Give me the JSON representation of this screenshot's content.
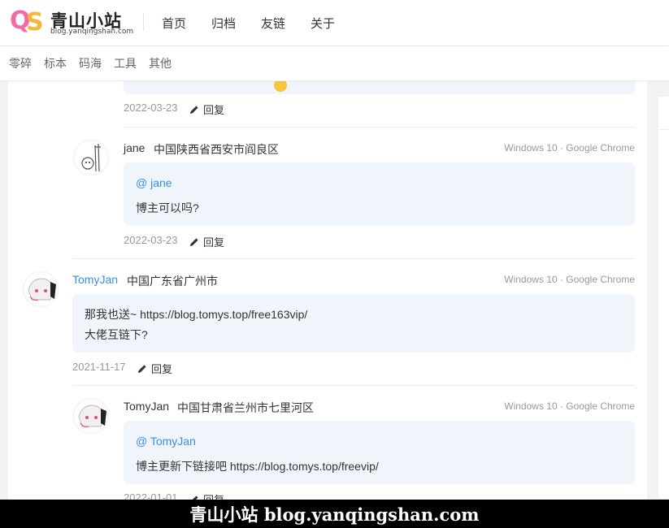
{
  "site": {
    "logo_title": "青山小站",
    "logo_sub": "blog.yanqingshan.com",
    "logo_mark_q": "Q",
    "logo_mark_s": "S"
  },
  "nav": [
    "首页",
    "归档",
    "友链",
    "关于"
  ],
  "categories": [
    "零碎",
    "标本",
    "码海",
    "工具",
    "其他"
  ],
  "reply_label": "回复",
  "comments": [
    {
      "date": "2022-03-23"
    },
    {
      "name": "jane",
      "location": "中国陕西省西安市阎良区",
      "ua": "Windows 10 · Google Chrome",
      "mention": "@ jane",
      "text": "博主可以吗?",
      "date": "2022-03-23"
    },
    {
      "name": "TomyJan",
      "location": "中国广东省广州市",
      "ua": "Windows 10 · Google Chrome",
      "line1": "那我也送~ https://blog.tomys.top/free163vip/",
      "line2": "大佬互链下?",
      "date": "2021-11-17"
    },
    {
      "name": "TomyJan",
      "location": "中国甘肃省兰州市七里河区",
      "ua": "Windows 10 · Google Chrome",
      "mention": "@ TomyJan",
      "text": "博主更新下链接吧 https://blog.tomys.top/freevip/",
      "date": "2022-01-01"
    }
  ],
  "watermark": "青山小站 blog.yanqingshan.com",
  "colors": {
    "link": "#3a8ee6",
    "bubble": "#f0f5fc",
    "logo_pink": "#f46aa5",
    "logo_yellow": "#f5b738"
  }
}
